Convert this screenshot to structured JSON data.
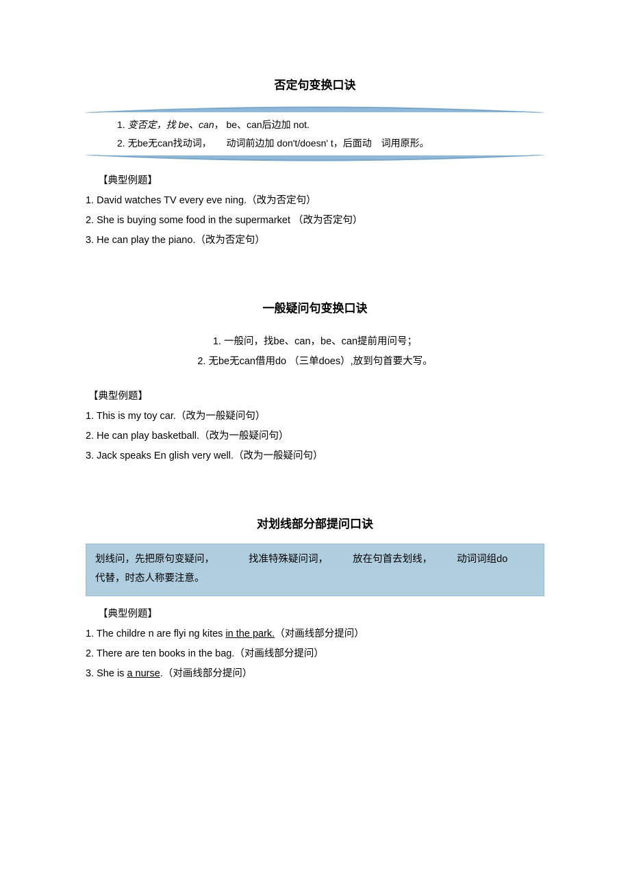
{
  "section1": {
    "title": "否定句变换口诀",
    "rules": {
      "line1_prefix": "1.",
      "line1_a": "变否定，找 be、can",
      "line1_b": "，",
      "line1_c": "be、can后边加 not.",
      "line2_prefix": "2.",
      "line2_a": "无be无can找动词，",
      "line2_b": "动词前边加 don't/doesn' t，后面动",
      "line2_c": "词用原形。"
    },
    "label": "【典型例题】",
    "ex1": "1.  David watches TV every eve ning.（改为否定句）",
    "ex2": "2.  She is buying some food in the supermarket （改为否定句）",
    "ex3": "3.  He can play the piano.（改为否定句）"
  },
  "section2": {
    "title": "一般疑问句变换口诀",
    "rules": {
      "line1": "1. 一般问，找be、can，be、can提前用问号；",
      "line2": "2. 无be无can借用do （三单does）,放到句首要大写。"
    },
    "label": "【典型例题】",
    "ex1": "1.  This is my toy car.（改为一般疑问句）",
    "ex2": "2.  He can play basketball.（改为一般疑问句）",
    "ex3": "3.  Jack speaks En glish very well.（改为一般疑问句）"
  },
  "section3": {
    "title": "对划线部分部提问口诀",
    "rules": {
      "part1": "划线问，先把原句变疑问，",
      "part2": "找准特殊疑问词，",
      "part3": "放在句首去划线，",
      "part4": "动词词组do",
      "part5": "代替，时态人称要注意。"
    },
    "label": "【典型例题】",
    "ex1_a": "1.  The childre n are flyi ng kites ",
    "ex1_u": "in the park.",
    "ex1_b": "（对画线部分提问）",
    "ex2": "2.  There are ten books in the bag.（对画线部分提问）",
    "ex3_a": "3.  She is ",
    "ex3_u": "a nurse",
    "ex3_b": ".（对画线部分提问）"
  }
}
